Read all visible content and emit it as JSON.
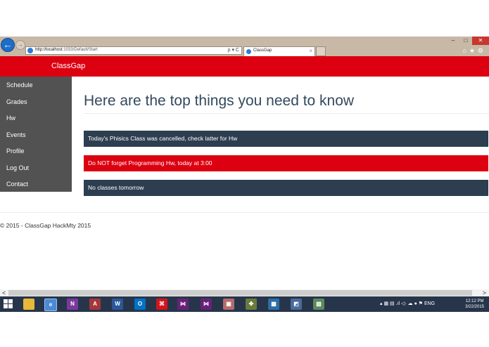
{
  "browser": {
    "url_host": "http://localhost",
    "url_path": ":1033/Default/Start",
    "address_controls": "ρ ▾ C",
    "tab_title": "ClassGap",
    "tab_close": "×",
    "window_buttons": [
      "–",
      "□",
      "✕"
    ],
    "toolbar_icons": [
      "home-icon",
      "star-icon",
      "gear-icon"
    ],
    "accent_color": "#1c6ec9"
  },
  "header": {
    "brand": "ClassGap",
    "color": "#dc0010"
  },
  "sidebar": {
    "items": [
      {
        "label": "Schedule"
      },
      {
        "label": "Grades"
      },
      {
        "label": "Hw"
      },
      {
        "label": "Events"
      },
      {
        "label": "Profile"
      },
      {
        "label": "Log Out"
      },
      {
        "label": "Contact"
      }
    ]
  },
  "main": {
    "title": "Here are the top things you need to know",
    "notices": [
      {
        "text": "Today's Phisics Class was cancelled, check latter for Hw",
        "color": "#2c3e50"
      },
      {
        "text": "Do NOT forget Programming Hw, today at 3:00",
        "color": "#dc0010"
      },
      {
        "text": "No classes tomorrow",
        "color": "#2c3e50"
      }
    ]
  },
  "footer": {
    "text": "© 2015 - ClassGap HackMty 2015"
  },
  "taskbar": {
    "apps": [
      {
        "name": "file-explorer-icon",
        "glyph": ""
      },
      {
        "name": "internet-explorer-icon",
        "glyph": "e"
      },
      {
        "name": "onenote-icon",
        "glyph": "N"
      },
      {
        "name": "access-icon",
        "glyph": "A"
      },
      {
        "name": "word-icon",
        "glyph": "W"
      },
      {
        "name": "outlook-icon",
        "glyph": "O"
      },
      {
        "name": "acrobat-icon",
        "glyph": "⌘"
      },
      {
        "name": "visual-studio-icon",
        "glyph": "⋈"
      },
      {
        "name": "visual-studio-2-icon",
        "glyph": "⋈"
      },
      {
        "name": "app-icon-1",
        "glyph": "▣"
      },
      {
        "name": "app-icon-2",
        "glyph": "✤"
      },
      {
        "name": "app-icon-3",
        "glyph": "▩"
      },
      {
        "name": "app-icon-4",
        "glyph": "◩"
      },
      {
        "name": "app-icon-5",
        "glyph": "▧"
      }
    ],
    "tray_text": "▴  ▦  ▤  .ıl  ◁·  ☁  ●  ⚑  ENG",
    "time": "12:12 PM",
    "date": "3/22/2015"
  }
}
